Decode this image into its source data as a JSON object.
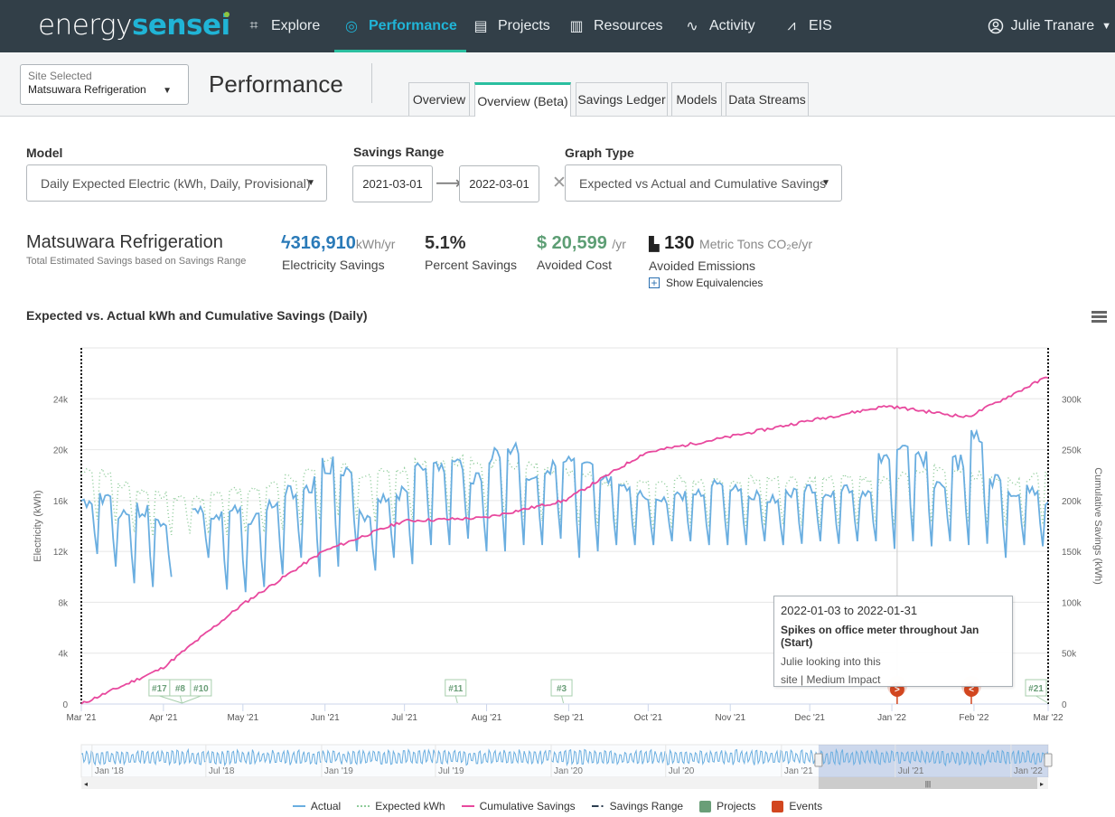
{
  "app": {
    "logo_left": "energy",
    "logo_right": "sensei"
  },
  "nav": {
    "items": [
      {
        "label": "Explore",
        "icon": "binoculars-icon",
        "glyph": "⌗",
        "active": false
      },
      {
        "label": "Performance",
        "icon": "target-icon",
        "glyph": "◎",
        "active": true
      },
      {
        "label": "Projects",
        "icon": "clipboard-icon",
        "glyph": "▤",
        "active": false
      },
      {
        "label": "Resources",
        "icon": "books-icon",
        "glyph": "▥",
        "active": false
      },
      {
        "label": "Activity",
        "icon": "pulse-icon",
        "glyph": "∿",
        "active": false
      },
      {
        "label": "EIS",
        "icon": "line-chart-icon",
        "glyph": "⩘",
        "active": false
      }
    ],
    "user": "Julie Tranare"
  },
  "subheader": {
    "site_select_label": "Site Selected",
    "site_select_value": "Matsuwara Refrigeration",
    "page_title": "Performance",
    "tabs": [
      "Overview",
      "Overview (Beta)",
      "Savings Ledger",
      "Models",
      "Data Streams"
    ],
    "active_tab": "Overview (Beta)"
  },
  "controls": {
    "model_label": "Model",
    "model_value": "Daily Expected Electric (kWh, Daily, Provisional)",
    "range_label": "Savings Range",
    "range_start": "2021-03-01",
    "range_end": "2022-03-01",
    "graph_type_label": "Graph Type",
    "graph_type_value": "Expected vs Actual and Cumulative Savings"
  },
  "summary": {
    "site_name": "Matsuwara Refrigeration",
    "subtitle": "Total Estimated Savings based on Savings Range",
    "electricity": {
      "value": "316,910",
      "unit": "kWh/yr",
      "label": "Electricity Savings",
      "color": "#2a7ab8"
    },
    "percent": {
      "value": "5.1%",
      "label": "Percent Savings"
    },
    "cost": {
      "value": "$ 20,599",
      "unit": "/yr",
      "label": "Avoided Cost",
      "color": "#5d9e74"
    },
    "emissions": {
      "value": "130",
      "unit": "Metric Tons CO₂e/yr",
      "label": "Avoided Emissions"
    },
    "equivalencies": "Show Equivalencies"
  },
  "tooltip": {
    "dates": "2022-01-03 to 2022-01-31",
    "title": "Spikes on office meter throughout Jan (Start)",
    "line3": "Julie looking into this",
    "line4": "site | Medium Impact"
  },
  "chart_data": {
    "type": "line",
    "title": "Expected vs. Actual kWh and Cumulative Savings (Daily)",
    "xlabel": "",
    "ylabel": "Electricity (kWh)",
    "y2label": "Cumulative Savings (kWh)",
    "x_range": [
      "2021-03-01",
      "2022-03-01"
    ],
    "ylim": [
      0,
      28000
    ],
    "y2lim": [
      0,
      350000
    ],
    "y_ticks": [
      "0",
      "4k",
      "8k",
      "12k",
      "16k",
      "20k",
      "24k"
    ],
    "y_tick_values": [
      0,
      4000,
      8000,
      12000,
      16000,
      20000,
      24000
    ],
    "y2_ticks": [
      "0",
      "50k",
      "100k",
      "150k",
      "200k",
      "250k",
      "300k"
    ],
    "y2_tick_values": [
      0,
      50000,
      100000,
      150000,
      200000,
      250000,
      300000
    ],
    "x_ticks": [
      "Mar '21",
      "Apr '21",
      "May '21",
      "Jun '21",
      "Jul '21",
      "Aug '21",
      "Sep '21",
      "Oct '21",
      "Nov '21",
      "Dec '21",
      "Jan '22",
      "Feb '22",
      "Mar '22"
    ],
    "grid": true,
    "legend_position": "bottom",
    "series": [
      {
        "name": "Actual",
        "color": "#6aaee0",
        "style": "solid",
        "weekly_high": [
          16500,
          17200,
          16000,
          16200,
          15000,
          0,
          15800,
          15500,
          16000,
          15500,
          16500,
          17500,
          18500,
          20200,
          19000,
          15500,
          17000,
          17500,
          20000,
          19500,
          19800,
          18800,
          20800,
          21300,
          18800,
          19500,
          20000,
          19500,
          18300,
          17500,
          17000,
          16500,
          17000,
          17200,
          18200,
          17800,
          17000,
          16800,
          17200,
          17500,
          17000,
          17500,
          17000,
          20700,
          20800,
          20500,
          18000,
          20000,
          22000,
          18500,
          17200,
          17500,
          16500,
          19200
        ],
        "weekly_low": [
          11800,
          10800,
          9500,
          9200,
          10000,
          0,
          11500,
          9000,
          8800,
          9200,
          10200,
          11500,
          10000,
          10800,
          12000,
          10500,
          11500,
          11000,
          12500,
          12500,
          13000,
          12000,
          12000,
          12500,
          12500,
          13000,
          11500,
          12000,
          12500,
          12500,
          12500,
          12800,
          12800,
          12500,
          12500,
          12500,
          12800,
          12500,
          12600,
          12800,
          12600,
          12800,
          12800,
          12200,
          12800,
          12400,
          12800,
          12500,
          12600,
          11500,
          12500,
          12400,
          12600,
          12500
        ]
      },
      {
        "name": "Expected kWh",
        "color": "#8fcc9a",
        "style": "dotted",
        "weekly_high": [
          18800,
          18800,
          17800,
          17200,
          17000,
          16700,
          16600,
          17000,
          17300,
          17400,
          17800,
          18300,
          19000,
          19800,
          19300,
          18800,
          18800,
          19000,
          19500,
          19800,
          19800,
          19800,
          19500,
          19500,
          19300,
          19000,
          18700,
          18500,
          18000,
          17800,
          17800,
          18000,
          18300,
          18200,
          18300,
          18200,
          18300,
          18400,
          18200,
          18100,
          18200,
          18300,
          18300,
          18200,
          18500,
          18800,
          19200,
          18800,
          18500,
          18300,
          18200,
          18500,
          18600,
          18700
        ],
        "weekly_low": [
          14500,
          14200,
          13500,
          13200,
          13300,
          13400,
          13400,
          13300,
          13500,
          13500,
          13700,
          14000,
          14500,
          14800,
          14600,
          14300,
          14300,
          14400,
          14600,
          14800,
          14800,
          14800,
          14600,
          14500,
          14400,
          14300,
          14100,
          14000,
          13800,
          13700,
          13700,
          13800,
          14000,
          13900,
          14000,
          13900,
          14000,
          14100,
          14000,
          13900,
          14000,
          14100,
          14100,
          14000,
          14200,
          14300,
          14500,
          14300,
          14200,
          14000,
          13900,
          14100,
          14200,
          14300
        ]
      },
      {
        "name": "Cumulative Savings",
        "color": "#e8499e",
        "style": "solid",
        "axis": "right",
        "monthly_values": [
          0,
          35000,
          98000,
          150000,
          180000,
          183000,
          200000,
          247000,
          262000,
          278000,
          293000,
          282000,
          322000
        ]
      },
      {
        "name": "Savings Range",
        "color": "#222222",
        "style": "dash-dot"
      }
    ],
    "project_markers": [
      {
        "label": "#17",
        "date": "2021-04-08"
      },
      {
        "label": "#8",
        "date": "2021-04-08"
      },
      {
        "label": "#10",
        "date": "2021-04-08"
      },
      {
        "label": "#11",
        "date": "2021-07-21"
      },
      {
        "label": "#3",
        "date": "2021-08-30"
      },
      {
        "label": "#21",
        "date": "2022-03-01"
      }
    ],
    "event_markers": [
      {
        "date": "2022-01-03",
        "glyph": ">"
      },
      {
        "date": "2022-01-31",
        "glyph": "<"
      }
    ],
    "navigator": {
      "x_ticks": [
        "Jan '18",
        "Jul '18",
        "Jan '19",
        "Jul '19",
        "Jan '20",
        "Jul '20",
        "Jan '21",
        "Jul '21",
        "Jan '22"
      ],
      "selected_range": [
        "2021-03-01",
        "2022-03-01"
      ]
    },
    "legend": [
      {
        "name": "Actual",
        "kind": "line",
        "color": "#6aaee0"
      },
      {
        "name": "Expected kWh",
        "kind": "dotted",
        "color": "#8fcc9a"
      },
      {
        "name": "Cumulative Savings",
        "kind": "line",
        "color": "#e8499e"
      },
      {
        "name": "Savings Range",
        "kind": "dashdot",
        "color": "#2c3e50"
      },
      {
        "name": "Projects",
        "kind": "square",
        "color": "#6a9e78"
      },
      {
        "name": "Events",
        "kind": "square",
        "color": "#d2461f"
      }
    ]
  }
}
